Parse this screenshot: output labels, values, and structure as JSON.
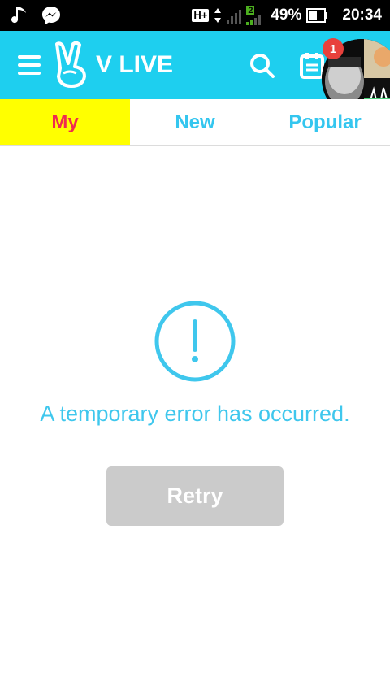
{
  "status_bar": {
    "battery_percent": "49%",
    "time": "20:34",
    "network_type": "H+",
    "sim_slot": "2",
    "icons": [
      "music-note-icon",
      "messenger-icon",
      "signal-icon",
      "battery-icon"
    ]
  },
  "app_bar": {
    "logo_text": "V LIVE",
    "notification_count": "1",
    "icons": [
      "menu-icon",
      "search-icon",
      "calendar-icon"
    ]
  },
  "tabs": [
    {
      "label": "My",
      "active": true
    },
    {
      "label": "New",
      "active": false
    },
    {
      "label": "Popular",
      "active": false
    }
  ],
  "error": {
    "message": "A temporary error has occurred.",
    "retry_label": "Retry",
    "icon": "alert-circle-icon"
  },
  "colors": {
    "app_bar": "#1ecfef",
    "active_tab_bg": "#ffff00",
    "active_tab_text": "#ef2a51",
    "inactive_tab_text": "#34c6ef",
    "error_text": "#3fc7ed",
    "retry_bg": "#cbcbcb",
    "badge": "#e8413c"
  }
}
